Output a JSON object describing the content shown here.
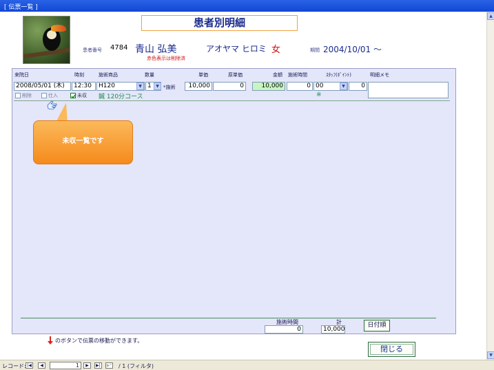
{
  "window": {
    "title": "[ 伝票一覧 ]"
  },
  "header": {
    "title": "患者別明細",
    "patient_no_label": "患者番号",
    "patient_no": "4784",
    "patient_name": "青山 弘美",
    "deleted_note": "赤色表示は削除済",
    "kana": "アオヤマ ヒロミ",
    "sex": "女",
    "period_label": "期間",
    "period_value": "2004/10/01 ～"
  },
  "columns": {
    "date": "来院日",
    "time": "時刻",
    "product": "施術商品",
    "qty": "数量",
    "unit_price": "単価",
    "cost": "原単価",
    "amount": "金額",
    "duration": "施術時間",
    "staff": "ｽﾀｯﾌ(ﾎﾟｲﾝﾄ)",
    "memo": "明細メモ"
  },
  "row": {
    "date": "2008/05/01 (木)",
    "time": "12:30",
    "product": "H120",
    "qty": "1",
    "kind": "*施術",
    "unit_price": "10,000",
    "cost": "0",
    "amount": "10,000",
    "duration": "0",
    "staff": "00",
    "point": "0",
    "memo": "",
    "cb_delete": "削除",
    "cb_purchase": "仕入",
    "cb_unpaid": "未収",
    "product_desc": "鍼 120分コース",
    "staff_mark": "※"
  },
  "callout": {
    "text": "未収一覧です"
  },
  "totals": {
    "duration_label": "施術時間",
    "total_label": "計",
    "duration": "0",
    "total": "10,000",
    "date_order_button": "日付順"
  },
  "footer": {
    "hint": "のボタンで伝票の移動ができます。",
    "close_button": "閉じる"
  },
  "statusbar": {
    "record_label": "レコード:",
    "current": "1",
    "of_total": "/ 1 (フィルタ)"
  },
  "colors": {
    "panel": "#e4e6fa",
    "title": "#1a2b8c",
    "callout": "#f5921e",
    "amount_bg": "#c8f5c0"
  },
  "icons": [
    "pointing-hand-icon",
    "red-arrow-icon",
    "dropdown-arrow-icon",
    "checkbox-icon"
  ]
}
